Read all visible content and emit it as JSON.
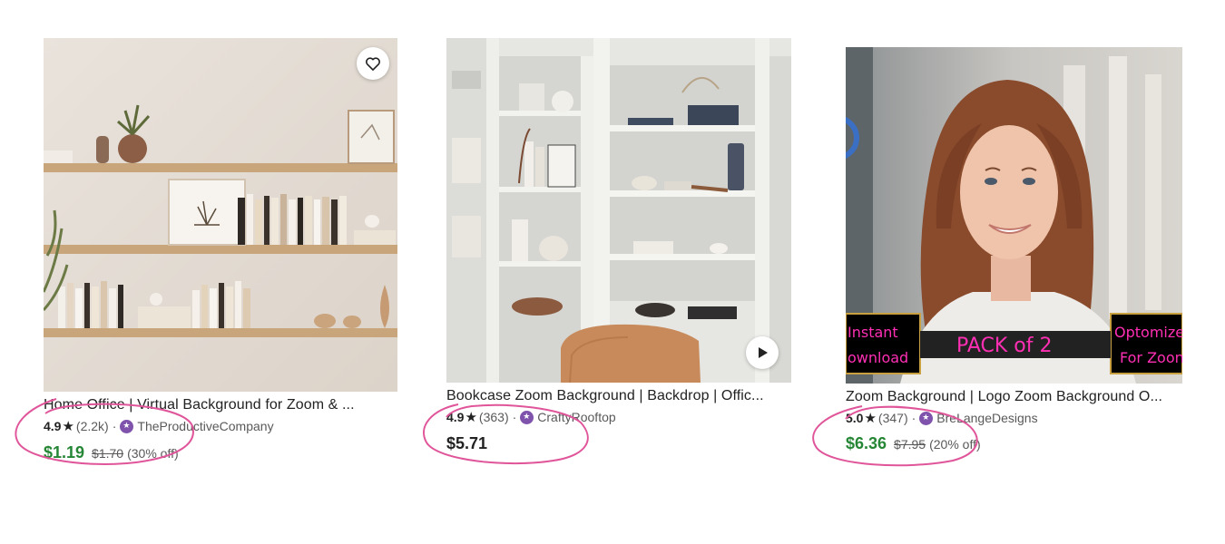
{
  "listings": [
    {
      "title": "Home Office | Virtual Background for Zoom & ...",
      "rating": "4.9",
      "review_count": "(2.2k)",
      "separator": "·",
      "shop": "TheProductiveCompany",
      "price": "$1.19",
      "original_price": "$1.70",
      "discount": "(30% off)",
      "on_sale": true,
      "favorite_icon": "heart-outline-icon"
    },
    {
      "title": "Bookcase Zoom Background | Backdrop | Offic...",
      "rating": "4.9",
      "review_count": "(363)",
      "separator": "·",
      "shop": "CraftyRooftop",
      "price": "$5.71",
      "on_sale": false,
      "video_icon": "play-icon"
    },
    {
      "title": "Zoom Background | Logo Zoom Background O...",
      "rating": "5.0",
      "review_count": "(347)",
      "separator": "·",
      "shop": "BreLangeDesigns",
      "price": "$6.36",
      "original_price": "$7.95",
      "discount": "(20% off)",
      "on_sale": true,
      "image_text": {
        "left_top": "Instant",
        "left_bottom": "ownload",
        "center": "PACK of 2",
        "right_top": "Optomize",
        "right_bottom": "For Zoon"
      }
    }
  ],
  "colors": {
    "sale_price": "#258635",
    "star_seller_badge": "#7f53ac",
    "annotation_circle": "#e0559a",
    "pack_text": "#ff2fb4"
  }
}
